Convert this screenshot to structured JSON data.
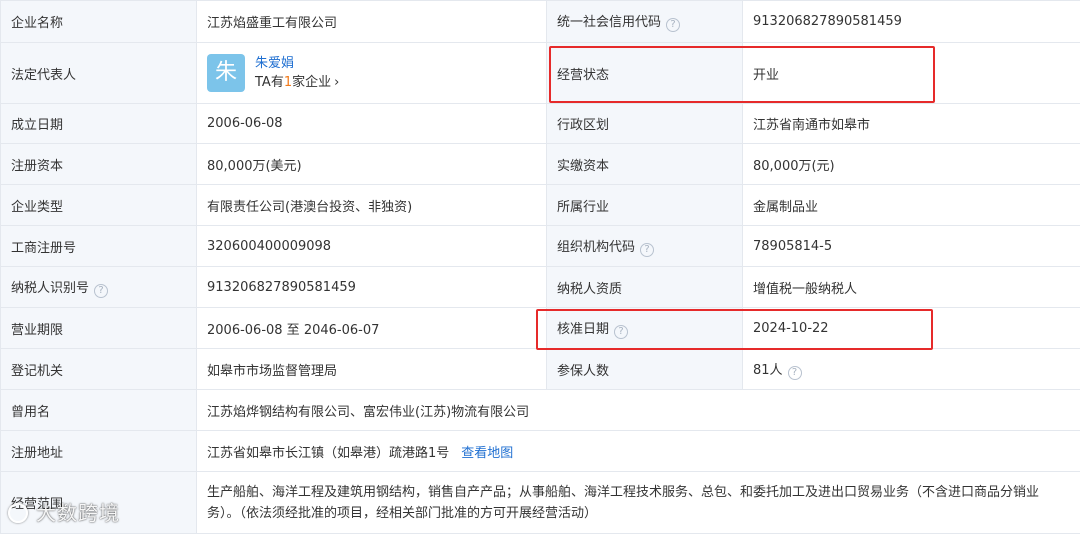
{
  "rows": {
    "company_name": {
      "label": "企业名称",
      "value": "江苏焰盛重工有限公司"
    },
    "credit_code": {
      "label": "统一社会信用代码",
      "value": "913206827890581459"
    },
    "legal_rep": {
      "label": "法定代表人",
      "avatar_char": "朱",
      "name": "朱爱娟",
      "sub_prefix": "TA有",
      "sub_count": "1",
      "sub_suffix": "家企业",
      "chevron": "›"
    },
    "status": {
      "label": "经营状态",
      "value": "开业"
    },
    "established": {
      "label": "成立日期",
      "value": "2006-06-08"
    },
    "region": {
      "label": "行政区划",
      "value": "江苏省南通市如皋市"
    },
    "reg_capital": {
      "label": "注册资本",
      "value": "80,000万(美元)"
    },
    "paid_capital": {
      "label": "实缴资本",
      "value": "80,000万(元)"
    },
    "company_type": {
      "label": "企业类型",
      "value": "有限责任公司(港澳台投资、非独资)"
    },
    "industry": {
      "label": "所属行业",
      "value": "金属制品业"
    },
    "reg_number": {
      "label": "工商注册号",
      "value": "320600400009098"
    },
    "org_code": {
      "label": "组织机构代码",
      "value": "78905814-5"
    },
    "taxpayer_id": {
      "label": "纳税人识别号",
      "value": "913206827890581459"
    },
    "taxpayer_qual": {
      "label": "纳税人资质",
      "value": "增值税一般纳税人"
    },
    "business_term": {
      "label": "营业期限",
      "value": "2006-06-08 至 2046-06-07"
    },
    "approval_date": {
      "label": "核准日期",
      "value": "2024-10-22"
    },
    "authority": {
      "label": "登记机关",
      "value": "如皋市市场监督管理局"
    },
    "insured": {
      "label": "参保人数",
      "value": "81人"
    },
    "former_names": {
      "label": "曾用名",
      "value": "江苏焰烨钢结构有限公司、富宏伟业(江苏)物流有限公司"
    },
    "address": {
      "label": "注册地址",
      "value": "江苏省如皋市长江镇（如皋港）疏港路1号",
      "link": "查看地图"
    },
    "scope": {
      "label": "经营范围",
      "value": "生产船舶、海洋工程及建筑用钢结构，销售自产产品；从事船舶、海洋工程技术服务、总包、和委托加工及进出口贸易业务（不含进口商品分销业务）。（依法须经批准的项目，经相关部门批准的方可开展经营活动）"
    }
  },
  "help_glyph": "?",
  "watermark": "大数跨境",
  "colors": {
    "label_bg": "#f4f7fb",
    "border": "#e4e8ee",
    "link": "#1f6fd1",
    "highlight": "#e62a2a",
    "avatar": "#7cc4ea",
    "count": "#f27a1a"
  },
  "icons": {
    "help": "question-circle-icon",
    "chevron": "chevron-right-icon",
    "watermark": "wechat-logo-icon"
  }
}
